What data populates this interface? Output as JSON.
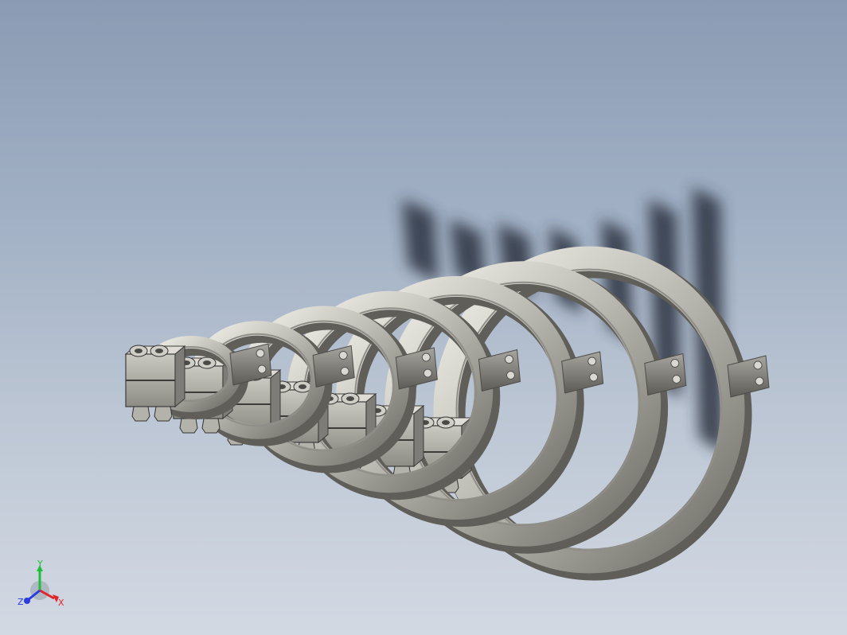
{
  "viewport": {
    "background_top": "#8a9bb3",
    "background_bottom": "#d3d9e3"
  },
  "model": {
    "part_color": "#b9b8b1",
    "shadow_color": "#2c3340",
    "clamp_count": 7
  },
  "triad": {
    "x_label": "X",
    "y_label": "Y",
    "z_label": "Z",
    "x_color": "#e0262b",
    "y_color": "#1fbf3a",
    "z_color": "#2a3be0"
  }
}
